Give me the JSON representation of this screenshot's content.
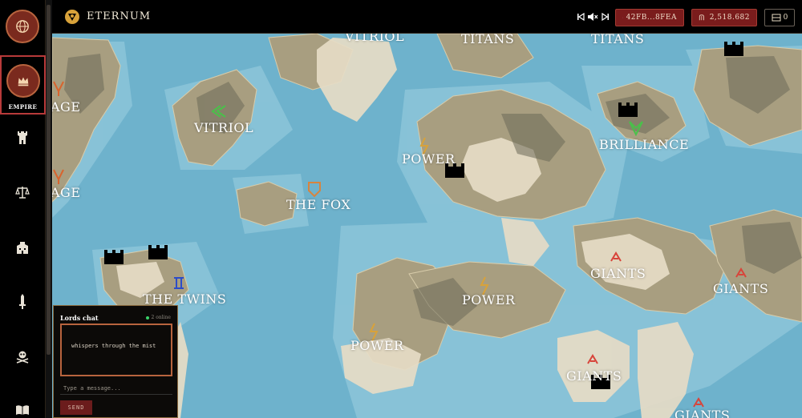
{
  "app": {
    "title": "ETERNUM"
  },
  "sidebar": {
    "items": [
      {
        "icon": "globe-icon"
      },
      {
        "icon": "crown-icon",
        "label": "EMPIRE",
        "active": true
      },
      {
        "icon": "castle-tower-icon"
      },
      {
        "icon": "scales-icon"
      },
      {
        "icon": "building-icon"
      },
      {
        "icon": "sword-icon"
      },
      {
        "icon": "skull-crossbones-icon"
      },
      {
        "icon": "book-icon"
      }
    ]
  },
  "header": {
    "media": [
      "previous-track-icon",
      "mute-icon",
      "next-track-icon"
    ],
    "address": "42FB...8FEA",
    "balance": "2,518.682",
    "view_count": "0"
  },
  "map": {
    "labels": [
      "VITRIOL",
      "TITANS",
      "TITANS",
      "AGE",
      "VITRIOL",
      "POWER",
      "BRILLIANCE",
      "AGE",
      "THE FOX",
      "THE TWINS",
      "POWER",
      "GIANTS",
      "GIANTS",
      "POWER",
      "GIANTS",
      "GIANTS"
    ]
  },
  "chat": {
    "title": "Lords chat",
    "online": "2 online",
    "messages": [
      "whispers through the mist"
    ],
    "placeholder": "Type a message...",
    "send_label": "SEND"
  },
  "colors": {
    "accent_red": "#7a1c1c",
    "ocean": "#6eb2cc",
    "land": "#a89e80",
    "sand": "#e6dcc6"
  }
}
